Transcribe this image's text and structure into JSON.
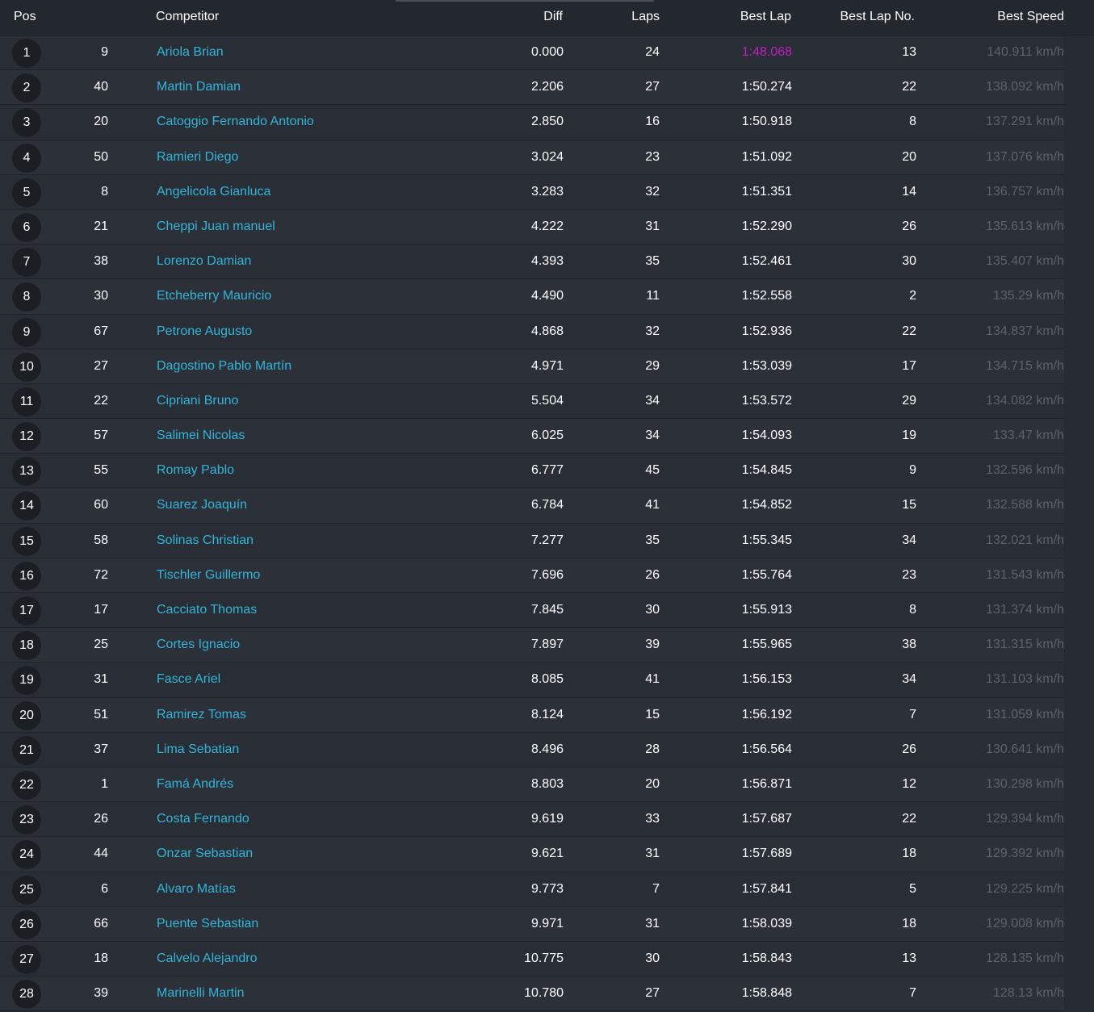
{
  "columns": {
    "pos": "Pos",
    "competitor": "Competitor",
    "diff": "Diff",
    "laps": "Laps",
    "best_lap": "Best Lap",
    "best_lap_no": "Best Lap No.",
    "best_speed": "Best Speed"
  },
  "colors": {
    "background": "#272b33",
    "name_link": "#33b5d8",
    "fastest_lap": "#c01fc0",
    "speed_text": "#5d626b"
  },
  "rows": [
    {
      "pos": "1",
      "number": "9",
      "name": "Ariola Brian",
      "diff": "0.000",
      "laps": "24",
      "best_lap": "1:48.068",
      "best_lap_no": "13",
      "best_speed": "140.911 km/h"
    },
    {
      "pos": "2",
      "number": "40",
      "name": "Martin Damian",
      "diff": "2.206",
      "laps": "27",
      "best_lap": "1:50.274",
      "best_lap_no": "22",
      "best_speed": "138.092 km/h"
    },
    {
      "pos": "3",
      "number": "20",
      "name": "Catoggio Fernando Antonio",
      "diff": "2.850",
      "laps": "16",
      "best_lap": "1:50.918",
      "best_lap_no": "8",
      "best_speed": "137.291 km/h"
    },
    {
      "pos": "4",
      "number": "50",
      "name": "Ramieri Diego",
      "diff": "3.024",
      "laps": "23",
      "best_lap": "1:51.092",
      "best_lap_no": "20",
      "best_speed": "137.076 km/h"
    },
    {
      "pos": "5",
      "number": "8",
      "name": "Angelicola Gianluca",
      "diff": "3.283",
      "laps": "32",
      "best_lap": "1:51.351",
      "best_lap_no": "14",
      "best_speed": "136.757 km/h"
    },
    {
      "pos": "6",
      "number": "21",
      "name": "Cheppi Juan manuel",
      "diff": "4.222",
      "laps": "31",
      "best_lap": "1:52.290",
      "best_lap_no": "26",
      "best_speed": "135.613 km/h"
    },
    {
      "pos": "7",
      "number": "38",
      "name": "Lorenzo Damian",
      "diff": "4.393",
      "laps": "35",
      "best_lap": "1:52.461",
      "best_lap_no": "30",
      "best_speed": "135.407 km/h"
    },
    {
      "pos": "8",
      "number": "30",
      "name": "Etcheberry Mauricio",
      "diff": "4.490",
      "laps": "11",
      "best_lap": "1:52.558",
      "best_lap_no": "2",
      "best_speed": "135.29 km/h"
    },
    {
      "pos": "9",
      "number": "67",
      "name": "Petrone Augusto",
      "diff": "4.868",
      "laps": "32",
      "best_lap": "1:52.936",
      "best_lap_no": "22",
      "best_speed": "134.837 km/h"
    },
    {
      "pos": "10",
      "number": "27",
      "name": "Dagostino Pablo Martín",
      "diff": "4.971",
      "laps": "29",
      "best_lap": "1:53.039",
      "best_lap_no": "17",
      "best_speed": "134.715 km/h"
    },
    {
      "pos": "11",
      "number": "22",
      "name": "Cipriani Bruno",
      "diff": "5.504",
      "laps": "34",
      "best_lap": "1:53.572",
      "best_lap_no": "29",
      "best_speed": "134.082 km/h"
    },
    {
      "pos": "12",
      "number": "57",
      "name": "Salimei Nicolas",
      "diff": "6.025",
      "laps": "34",
      "best_lap": "1:54.093",
      "best_lap_no": "19",
      "best_speed": "133.47 km/h"
    },
    {
      "pos": "13",
      "number": "55",
      "name": "Romay Pablo",
      "diff": "6.777",
      "laps": "45",
      "best_lap": "1:54.845",
      "best_lap_no": "9",
      "best_speed": "132.596 km/h"
    },
    {
      "pos": "14",
      "number": "60",
      "name": "Suarez Joaquín",
      "diff": "6.784",
      "laps": "41",
      "best_lap": "1:54.852",
      "best_lap_no": "15",
      "best_speed": "132.588 km/h"
    },
    {
      "pos": "15",
      "number": "58",
      "name": "Solinas Christian",
      "diff": "7.277",
      "laps": "35",
      "best_lap": "1:55.345",
      "best_lap_no": "34",
      "best_speed": "132.021 km/h"
    },
    {
      "pos": "16",
      "number": "72",
      "name": "Tischler Guillermo",
      "diff": "7.696",
      "laps": "26",
      "best_lap": "1:55.764",
      "best_lap_no": "23",
      "best_speed": "131.543 km/h"
    },
    {
      "pos": "17",
      "number": "17",
      "name": "Cacciato Thomas",
      "diff": "7.845",
      "laps": "30",
      "best_lap": "1:55.913",
      "best_lap_no": "8",
      "best_speed": "131.374 km/h"
    },
    {
      "pos": "18",
      "number": "25",
      "name": "Cortes Ignacio",
      "diff": "7.897",
      "laps": "39",
      "best_lap": "1:55.965",
      "best_lap_no": "38",
      "best_speed": "131.315 km/h"
    },
    {
      "pos": "19",
      "number": "31",
      "name": "Fasce Ariel",
      "diff": "8.085",
      "laps": "41",
      "best_lap": "1:56.153",
      "best_lap_no": "34",
      "best_speed": "131.103 km/h"
    },
    {
      "pos": "20",
      "number": "51",
      "name": "Ramirez Tomas",
      "diff": "8.124",
      "laps": "15",
      "best_lap": "1:56.192",
      "best_lap_no": "7",
      "best_speed": "131.059 km/h"
    },
    {
      "pos": "21",
      "number": "37",
      "name": "Lima Sebatian",
      "diff": "8.496",
      "laps": "28",
      "best_lap": "1:56.564",
      "best_lap_no": "26",
      "best_speed": "130.641 km/h"
    },
    {
      "pos": "22",
      "number": "1",
      "name": "Famá Andrés",
      "diff": "8.803",
      "laps": "20",
      "best_lap": "1:56.871",
      "best_lap_no": "12",
      "best_speed": "130.298 km/h"
    },
    {
      "pos": "23",
      "number": "26",
      "name": "Costa Fernando",
      "diff": "9.619",
      "laps": "33",
      "best_lap": "1:57.687",
      "best_lap_no": "22",
      "best_speed": "129.394 km/h"
    },
    {
      "pos": "24",
      "number": "44",
      "name": "Onzar Sebastian",
      "diff": "9.621",
      "laps": "31",
      "best_lap": "1:57.689",
      "best_lap_no": "18",
      "best_speed": "129.392 km/h"
    },
    {
      "pos": "25",
      "number": "6",
      "name": "Alvaro Matías",
      "diff": "9.773",
      "laps": "7",
      "best_lap": "1:57.841",
      "best_lap_no": "5",
      "best_speed": "129.225 km/h"
    },
    {
      "pos": "26",
      "number": "66",
      "name": "Puente Sebastian",
      "diff": "9.971",
      "laps": "31",
      "best_lap": "1:58.039",
      "best_lap_no": "18",
      "best_speed": "129.008 km/h"
    },
    {
      "pos": "27",
      "number": "18",
      "name": "Calvelo Alejandro",
      "diff": "10.775",
      "laps": "30",
      "best_lap": "1:58.843",
      "best_lap_no": "13",
      "best_speed": "128.135 km/h"
    },
    {
      "pos": "28",
      "number": "39",
      "name": "Marinelli Martin",
      "diff": "10.780",
      "laps": "27",
      "best_lap": "1:58.848",
      "best_lap_no": "7",
      "best_speed": "128.13 km/h"
    }
  ]
}
